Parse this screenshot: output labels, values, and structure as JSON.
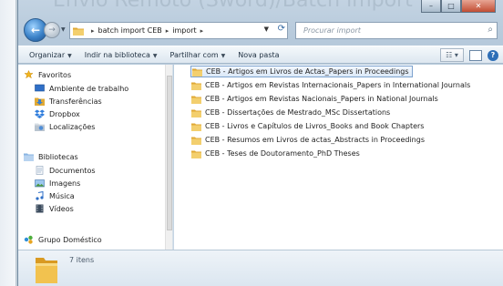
{
  "background_title": "Envio Remoto (Sword)/Batch import",
  "address": {
    "crumbs": [
      "batch import CEB",
      "import"
    ],
    "search_placeholder": "Procurar import"
  },
  "toolbar": {
    "organize": "Organizar",
    "include_library": "Indir na biblioteca",
    "share": "Partilhar com",
    "new_folder": "Nova pasta"
  },
  "navpane": {
    "favorites": "Favoritos",
    "fav_items": [
      "Ambiente de trabalho",
      "Transferências",
      "Dropbox",
      "Localizações"
    ],
    "libraries": "Bibliotecas",
    "lib_items": [
      "Documentos",
      "Imagens",
      "Música",
      "Vídeos"
    ],
    "homegroup": "Grupo Doméstico"
  },
  "files": [
    "CEB - Artigos em Livros de Actas_Papers in Proceedings",
    "CEB - Artigos em Revistas Internacionais_Papers in International Journals",
    "CEB - Artigos em Revistas Nacionais_Papers in National Journals",
    "CEB - Dissertações de Mestrado_MSc Dissertations",
    "CEB - Livros e Capítulos de Livros_Books and Book Chapters",
    "CEB - Resumos em Livros de actas_Abstracts in Proceedings",
    "CEB - Teses de Doutoramento_PhD Theses"
  ],
  "details": {
    "count": "7 itens"
  },
  "colors": {
    "folder": "#e8b84a",
    "accent": "#3b82c8",
    "selection": "#dce9f8"
  }
}
